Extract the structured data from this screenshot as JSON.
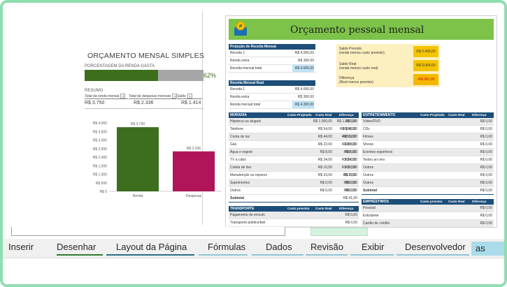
{
  "left": {
    "title": "ORÇAMENTO MENSAL SIMPLES",
    "subtitle": "PORCENTAGEM DA RENDA GASTA",
    "percent_value": 0.62,
    "percent_label": "62%",
    "resumo": "RESUMO",
    "headers": [
      "Total da renda mensal",
      "Total de despesas mensais",
      "Saldo"
    ],
    "values": [
      "R$ 3.750",
      "R$ 2.336",
      "R$ 1.414"
    ],
    "colors": {
      "green": "#3c6e1e",
      "magenta": "#b0155a",
      "grey": "#a6a6a6"
    }
  },
  "chart_data": {
    "type": "bar",
    "categories": [
      "Renda",
      "Despesas"
    ],
    "values": [
      3750,
      2336
    ],
    "data_labels": [
      "R$ 3.750",
      "R$ 2.336"
    ],
    "yticks": [
      "R$ 0",
      "R$ 500",
      "R$ 1.000",
      "R$ 1.500",
      "R$ 2.000",
      "R$ 2.500",
      "R$ 3.000",
      "R$ 3.500",
      "R$ 4.000"
    ],
    "ylim": [
      0,
      4000
    ],
    "colors": [
      "#3c6e1e",
      "#b0155a"
    ]
  },
  "right": {
    "title": "Orçamento pessoal mensal",
    "projecao": {
      "header": "Projeção de Receita Mensal",
      "rows": [
        [
          "Receita 1",
          "R$ 4.000,00"
        ],
        [
          "Renda extra",
          "R$ 300,00"
        ],
        [
          "Receita mensal total",
          "R$ 4.600,00"
        ]
      ]
    },
    "real": {
      "header": "Receita Mensal Real",
      "rows": [
        [
          "Receita 1",
          "R$ 4.000,00"
        ],
        [
          "Renda extra",
          "R$ 300,00"
        ],
        [
          "Renda mensal total",
          "R$ 4.300,00"
        ]
      ]
    },
    "saldo": [
      {
        "label": "Saldo Previsto",
        "sub": "(renda menos custo previsto)",
        "value": "R$ 3.405,00"
      },
      {
        "label": "Saldo Real",
        "sub": "(renda menos custo real)",
        "value": "R$ 3.064,00"
      },
      {
        "label": "Diferença",
        "sub": "(Real menos previsto)",
        "value": "-R$ 341,00"
      }
    ],
    "moradia": {
      "header": "MORADIA",
      "cols": [
        "Custo Projetado",
        "Custo Real",
        "Diferença"
      ],
      "rows": [
        [
          "Hipoteca ou aluguel",
          "R$ 1.000,00",
          "R$ 1.000,00",
          "R$ 0,00"
        ],
        [
          "Telefone",
          "R$ 54,00",
          "R$ 100,00",
          "-R$ 46,00"
        ],
        [
          "Conta de luz",
          "R$ 44,00",
          "R$ 56,00",
          "-R$ 12,00"
        ],
        [
          "Gás",
          "R$ 22,00",
          "R$ 28,00",
          "-R$ 6,00"
        ],
        [
          "Água e esgoto",
          "R$ 8,00",
          "R$ 8,00",
          "R$ 0,00"
        ],
        [
          "TV a cabo",
          "R$ 34,00",
          "R$ 34,00",
          "R$ 0,00"
        ],
        [
          "Coleta de lixo",
          "R$ 10,00",
          "R$ 10,00",
          "R$ 0,00"
        ],
        [
          "Manutenção ou reparos",
          "R$ 23,00",
          "R$ 0,00",
          "R$ 23,00"
        ],
        [
          "Suprimentos",
          "R$ 0,00",
          "R$ 0,00",
          "R$ 0,00"
        ],
        [
          "Outros",
          "R$ 0,00",
          "R$ 0,00",
          "R$ 0,00"
        ]
      ],
      "subtotal_label": "Subtotal",
      "subtotal_value": "R$ 41,00"
    },
    "entretenimento": {
      "header": "ENTRETENIMENTO",
      "cols": [
        "Custo Projetado",
        "Custo Real",
        "Diferença"
      ],
      "rows": [
        [
          "Vídeo/DVD",
          "R$ 0,00"
        ],
        [
          "CDs",
          "R$ 0,00"
        ],
        [
          "Filmes",
          "R$ 0,00"
        ],
        [
          "Shows",
          "R$ 0,00"
        ],
        [
          "Eventos esportivos",
          "R$ 0,00"
        ],
        [
          "Teatro ao vivo",
          "R$ 0,00"
        ],
        [
          "Outros",
          "R$ 0,00"
        ],
        [
          "Outros",
          "R$ 0,00"
        ],
        [
          "Outros",
          "R$ 0,00"
        ]
      ],
      "subtotal_label": "Subtotal",
      "subtotal_value": "R$ 0,00"
    },
    "transporte": {
      "header": "TRANSPORTE",
      "cols": [
        "Custo previsto",
        "Custo Real",
        "Diferença"
      ],
      "rows": [
        [
          "Pagamento do veículo",
          "R$ 0,00"
        ],
        [
          "Transporte público/táxi",
          "R$ 0,00"
        ]
      ]
    },
    "emprestimos": {
      "header": "EMPRÉSTIMOS",
      "cols": [
        "Custo previsto",
        "Custo Real",
        "Diferença"
      ],
      "rows": [
        [
          "Pessoal",
          "R$ 0,00"
        ],
        [
          "Estudante",
          "R$ 0,00"
        ],
        [
          "Cartão de crédito",
          "R$ 0,00"
        ]
      ]
    }
  },
  "ribbon": {
    "tabs": [
      "Inserir",
      "Desenhar",
      "Layout da Página",
      "Fórmulas",
      "Dados",
      "Revisão",
      "Exibir",
      "Desenvolvedor",
      "as"
    ]
  }
}
